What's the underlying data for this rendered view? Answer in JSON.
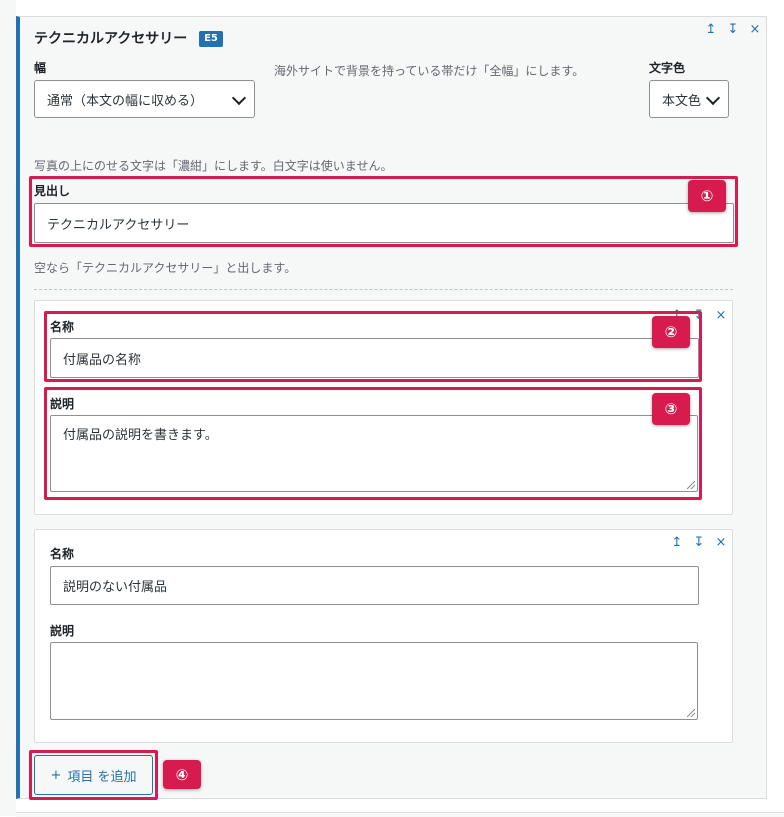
{
  "block": {
    "title": "テクニカルアクセサリー",
    "badge": "E5",
    "controls": {
      "up": "↥",
      "down": "↧",
      "remove": "×"
    }
  },
  "width_field": {
    "label": "幅",
    "value": "通常（本文の幅に収める）",
    "help": "海外サイトで背景を持っている帯だけ「全幅」にします。"
  },
  "text_color_field": {
    "label": "文字色",
    "value": "本文色"
  },
  "photo_help": "写真の上にのせる文字は「濃紺」にします。白文字は使いません。",
  "heading_field": {
    "label": "見出し",
    "value": "テクニカルアクセサリー",
    "help": "空なら「テクニカルアクセサリー」と出します。"
  },
  "items": [
    {
      "name_label": "名称",
      "name_value": "付属品の名称",
      "desc_label": "説明",
      "desc_value": "付属品の説明を書きます。"
    },
    {
      "name_label": "名称",
      "name_value": "説明のない付属品",
      "desc_label": "説明",
      "desc_value": ""
    }
  ],
  "add_button": {
    "icon": "+",
    "label": "項目 を追加"
  },
  "callouts": [
    "①",
    "②",
    "③",
    "④"
  ],
  "colors": {
    "accent": "#2271b1",
    "highlight": "#d81b4f"
  }
}
